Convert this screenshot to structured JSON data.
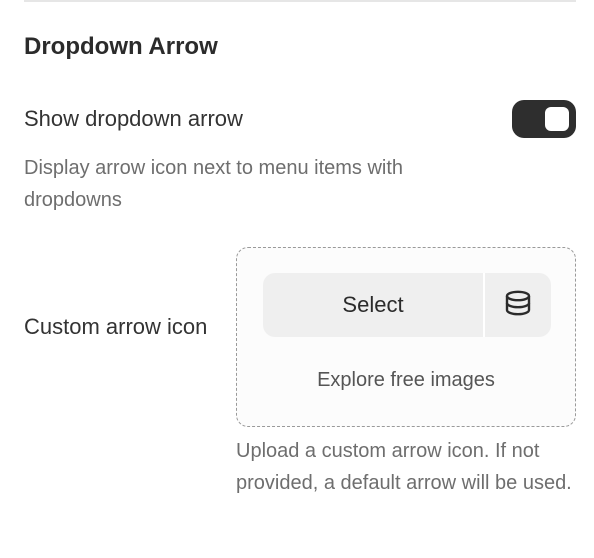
{
  "section": {
    "title": "Dropdown Arrow"
  },
  "show_arrow": {
    "label": "Show dropdown arrow",
    "enabled": true,
    "description": "Display arrow icon next to menu items with dropdowns"
  },
  "custom_icon": {
    "label": "Custom arrow icon",
    "select_label": "Select",
    "library_icon": "database-icon",
    "explore_label": "Explore free images",
    "help_text": "Upload a custom arrow icon. If not provided, a default arrow will be used."
  },
  "colors": {
    "toggle_on": "#2e2e2e",
    "button_bg": "#efefef",
    "muted_text": "#6e6e6e"
  }
}
